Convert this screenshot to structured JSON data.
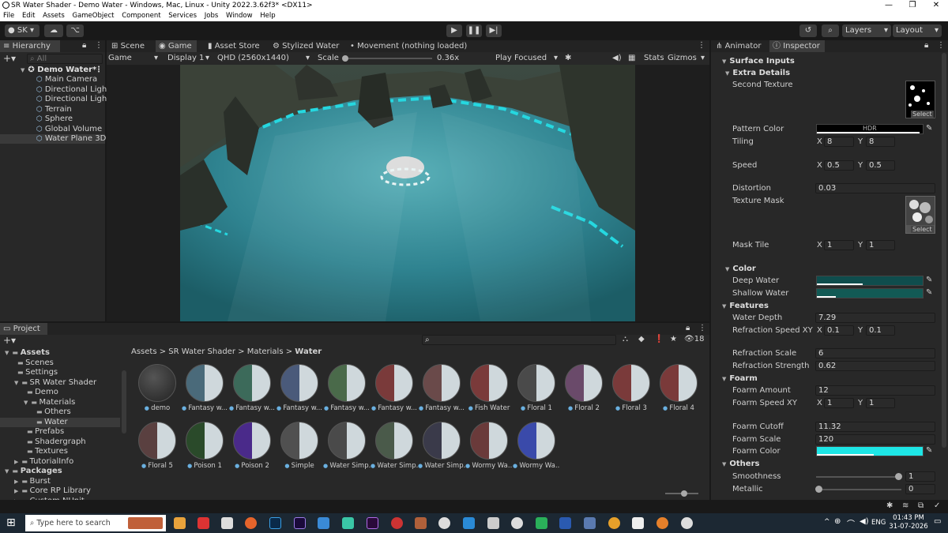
{
  "window": {
    "title": "SR Water Shader - Demo Water - Windows, Mac, Linux - Unity 2022.3.62f3* <DX11>",
    "controls": [
      "—",
      "❐",
      "✕"
    ]
  },
  "menubar": [
    "File",
    "Edit",
    "Assets",
    "GameObject",
    "Component",
    "Services",
    "Jobs",
    "Window",
    "Help"
  ],
  "toolbar": {
    "account": "SK",
    "layers": "Layers",
    "layout": "Layout"
  },
  "hierarchy": {
    "tab": "Hierarchy",
    "search_placeholder": "All",
    "scene": "Demo Water*",
    "items": [
      "Main Camera",
      "Directional Ligh",
      "Directional Ligh",
      "Terrain",
      "Sphere",
      "Global Volume",
      "Water Plane 3D"
    ],
    "selected": "Water Plane 3D"
  },
  "center": {
    "tabs": [
      "Scene",
      "Game",
      "Asset Store",
      "Stylized Water",
      "Movement (nothing loaded)"
    ],
    "active_tab": "Game",
    "game_toolbar": {
      "mode": "Game",
      "display": "Display 1",
      "resolution": "QHD (2560x1440)",
      "scale_label": "Scale",
      "scale_value": "0.36x",
      "play_focus": "Play Focused",
      "stats": "Stats",
      "gizmos": "Gizmos"
    }
  },
  "project": {
    "tab": "Project",
    "breadcrumb": [
      "Assets",
      "SR Water Shader",
      "Materials",
      "Water"
    ],
    "count": "18",
    "tree": [
      {
        "label": "Assets",
        "indent": 0,
        "bold": true
      },
      {
        "label": "Scenes",
        "indent": 1
      },
      {
        "label": "Settings",
        "indent": 1
      },
      {
        "label": "SR Water Shader",
        "indent": 1
      },
      {
        "label": "Demo",
        "indent": 2
      },
      {
        "label": "Materials",
        "indent": 2
      },
      {
        "label": "Others",
        "indent": 3
      },
      {
        "label": "Water",
        "indent": 3,
        "selected": true
      },
      {
        "label": "Prefabs",
        "indent": 2
      },
      {
        "label": "Shadergraph",
        "indent": 2
      },
      {
        "label": "Textures",
        "indent": 2
      },
      {
        "label": "TutorialInfo",
        "indent": 1
      },
      {
        "label": "Packages",
        "indent": 0,
        "bold": true
      },
      {
        "label": "Burst",
        "indent": 1
      },
      {
        "label": "Core RP Library",
        "indent": 1
      },
      {
        "label": "Custom NUnit",
        "indent": 1
      }
    ],
    "materials": [
      {
        "name": "demo",
        "color": "#3a3a3a"
      },
      {
        "name": "Fantasy w...",
        "color": "#4a6a7a"
      },
      {
        "name": "Fantasy w...",
        "color": "#3c6a5a"
      },
      {
        "name": "Fantasy w...",
        "color": "#4a5a7a"
      },
      {
        "name": "Fantasy w...",
        "color": "#4a6a4a"
      },
      {
        "name": "Fantasy w...",
        "color": "#7a3a3a"
      },
      {
        "name": "Fantasy w...",
        "color": "#6a4a4a"
      },
      {
        "name": "Fish Water",
        "color": "#7a3a3a"
      },
      {
        "name": "Floral 1",
        "color": "#4a4a4a"
      },
      {
        "name": "Floral 2",
        "color": "#6a4a6a"
      },
      {
        "name": "Floral 3",
        "color": "#7a3a3a"
      },
      {
        "name": "Floral 4",
        "color": "#7a3a3a"
      },
      {
        "name": "Floral 5",
        "color": "#5a4040"
      },
      {
        "name": "Poison 1",
        "color": "#2a4a2a"
      },
      {
        "name": "Poison 2",
        "color": "#4a2a8a"
      },
      {
        "name": "Simple",
        "color": "#505050"
      },
      {
        "name": "Water Simp...",
        "color": "#4a4a4a"
      },
      {
        "name": "Water Simp...",
        "color": "#4a5a4a"
      },
      {
        "name": "Water Simp...",
        "color": "#3a3a4a"
      },
      {
        "name": "Wormy Wa...",
        "color": "#6a3a3a"
      },
      {
        "name": "Wormy Wa...",
        "color": "#3a4aaa"
      }
    ]
  },
  "inspector": {
    "tabs": [
      "Animator",
      "Inspector"
    ],
    "active_tab": "Inspector",
    "surface_inputs": "Surface Inputs",
    "extra_details": "Extra Details",
    "second_texture": "Second Texture",
    "select": "Select",
    "pattern_color": "Pattern Color",
    "hdr": "HDR",
    "tiling": {
      "label": "Tiling",
      "x": "8",
      "y": "8"
    },
    "speed": {
      "label": "Speed",
      "x": "0.5",
      "y": "0.5"
    },
    "distortion": {
      "label": "Distortion",
      "value": "0.03"
    },
    "texture_mask": "Texture Mask",
    "mask_tile": {
      "label": "Mask Tile",
      "x": "1",
      "y": "1"
    },
    "color_section": "Color",
    "deep_water": "Deep Water",
    "shallow_water": "Shallow Water",
    "features_section": "Features",
    "water_depth": {
      "label": "Water Depth",
      "value": "7.29"
    },
    "refraction_speed": {
      "label": "Refraction Speed XY",
      "x": "0.1",
      "y": "0.1"
    },
    "refraction_scale": {
      "label": "Refraction Scale",
      "value": "6"
    },
    "refraction_strength": {
      "label": "Refraction Strength",
      "value": "0.62"
    },
    "foam_section": "Foarm",
    "foam_amount": {
      "label": "Foarm Amount",
      "value": "12"
    },
    "foam_speed": {
      "label": "Foarm Speed XY",
      "x": "1",
      "y": "1"
    },
    "foam_cutoff": {
      "label": "Foarm Cutoff",
      "value": "11.32"
    },
    "foam_scale": {
      "label": "Foarm Scale",
      "value": "120"
    },
    "foam_color": "Foarm Color",
    "others_section": "Others",
    "smoothness": {
      "label": "Smoothness",
      "value": "1"
    },
    "metallic": {
      "label": "Metallic",
      "value": "0"
    },
    "x_label": "X",
    "y_label": "Y"
  },
  "colors": {
    "deep_water": "#0f4d4d",
    "shallow_water": "#125a55",
    "foam": "#1ee6e6",
    "water": "#2c7f8a"
  },
  "taskbar": {
    "search_placeholder": "Type here to search",
    "lang": "ENG",
    "time": "01:43 PM",
    "date": "31-07-2026"
  }
}
